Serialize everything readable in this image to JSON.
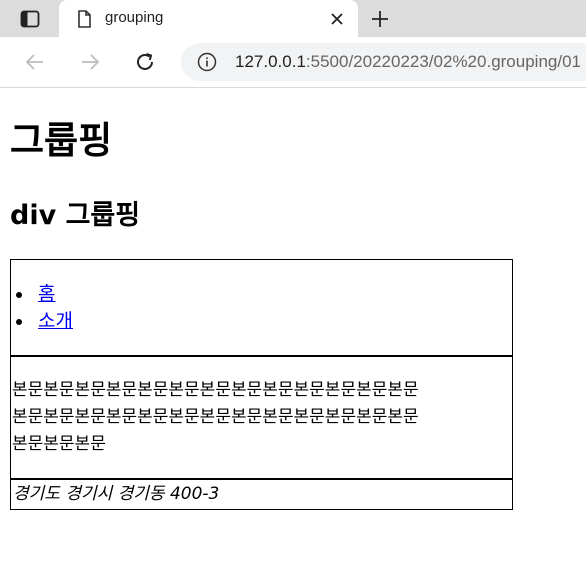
{
  "browser": {
    "tab_title": "grouping",
    "url_host": "127.0.0.1",
    "url_rest": ":5500/20220223/02%20.grouping/01"
  },
  "page": {
    "h1": "그룹핑",
    "h2": "div 그룹핑",
    "nav_items": [
      {
        "label": "홈"
      },
      {
        "label": "소개"
      }
    ],
    "section_text": "본문본문본문본문본문본문본문본문본문본문본문본문본문본문본문본문본문본문본문본문본문본문본문본문본문본문본문본문본문",
    "address": "경기도 경기시 경기동 400-3"
  }
}
